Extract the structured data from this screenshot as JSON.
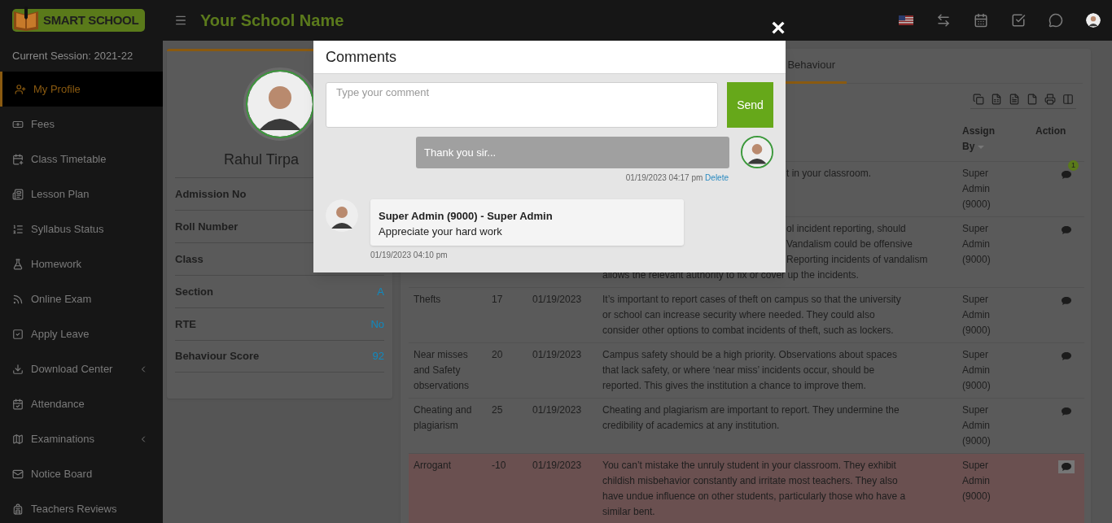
{
  "header": {
    "logo_text": "SMART SCHOOL",
    "school_name": "Your School Name"
  },
  "sidebar": {
    "session": "Current Session: 2021-22",
    "items": [
      {
        "label": "My Profile",
        "selected": true,
        "has_submenu": false
      },
      {
        "label": "Fees",
        "selected": false,
        "has_submenu": false
      },
      {
        "label": "Class Timetable",
        "selected": false,
        "has_submenu": false
      },
      {
        "label": "Lesson Plan",
        "selected": false,
        "has_submenu": false
      },
      {
        "label": "Syllabus Status",
        "selected": false,
        "has_submenu": false
      },
      {
        "label": "Homework",
        "selected": false,
        "has_submenu": false
      },
      {
        "label": "Online Exam",
        "selected": false,
        "has_submenu": false
      },
      {
        "label": "Apply Leave",
        "selected": false,
        "has_submenu": false
      },
      {
        "label": "Download Center",
        "selected": false,
        "has_submenu": true
      },
      {
        "label": "Attendance",
        "selected": false,
        "has_submenu": false
      },
      {
        "label": "Examinations",
        "selected": false,
        "has_submenu": true
      },
      {
        "label": "Notice Board",
        "selected": false,
        "has_submenu": false
      },
      {
        "label": "Teachers Reviews",
        "selected": false,
        "has_submenu": false
      }
    ]
  },
  "profile": {
    "name": "Rahul Tirpa",
    "fields": [
      {
        "label": "Admission No"
      },
      {
        "label": "Roll Number"
      },
      {
        "label": "Class"
      },
      {
        "label": "Section",
        "value": "A"
      },
      {
        "label": "RTE",
        "value": "No"
      },
      {
        "label": "Behaviour Score",
        "value": "92"
      }
    ]
  },
  "tabs": [
    {
      "label": "Behaviour",
      "selected": true
    }
  ],
  "table": {
    "columns": [
      "Assign By",
      "Action"
    ],
    "rows": [
      {
        "description_tail": [
          "t in your classroom."
        ],
        "assign_by": "Super Admin (9000)",
        "comment_count": "1",
        "highlighted": false,
        "hovered": false
      },
      {
        "description_tail": [
          "ol incident reporting, should",
          "Vandalism could be offensive",
          "Reporting incidents of vandalism"
        ],
        "description_lines": [
          "allows the relevant authority to fix or cover up the incidents."
        ],
        "assign_by": "Super Admin (9000)",
        "highlighted": false,
        "hovered": false
      },
      {
        "name": "Thefts",
        "points": "17",
        "date": "01/19/2023",
        "description_lines": [
          "It’s important to report cases of theft on campus so that the university",
          "or school can increase security where needed. They could also",
          "consider other options to combat incidents of theft, such as lockers."
        ],
        "assign_by": "Super Admin (9000)",
        "highlighted": false,
        "hovered": false
      },
      {
        "name": "Near misses and Safety observations",
        "points": "20",
        "date": "01/19/2023",
        "description_lines": [
          "Campus safety should be a high priority. Observations about spaces",
          "that lack safety, or where ‘near miss’ incidents occur, should be",
          "reported. This gives the institution a chance to improve them."
        ],
        "assign_by": "Super Admin (9000)",
        "highlighted": false,
        "hovered": false
      },
      {
        "name": "Cheating and plagiarism",
        "points": "25",
        "date": "01/19/2023",
        "description_lines": [
          "Cheating and plagiarism are important to report. They undermine the",
          "credibility of academics at any institution."
        ],
        "assign_by": "Super Admin (9000)",
        "highlighted": false,
        "hovered": false
      },
      {
        "name": "Arrogant",
        "points": "-10",
        "date": "01/19/2023",
        "description_lines": [
          "You can’t mistake the unruly student in your classroom. They exhibit",
          "childish misbehavior constantly and irritate most teachers. They also",
          "have undue influence on other students, particularly those who have a",
          "similar bent."
        ],
        "assign_by": "Super Admin (9000)",
        "highlighted": true,
        "hovered": true
      }
    ]
  },
  "modal": {
    "close": "×",
    "title": "Comments",
    "placeholder": "Type your comment",
    "send": "Send",
    "messages": [
      {
        "kind": "sent",
        "text": "Thank you sir...",
        "time": "01/19/2023 04:17 pm",
        "action": "Delete"
      },
      {
        "kind": "received",
        "author": "Super Admin (9000) - Super Admin",
        "text": "Appreciate your hard work",
        "time": "01/19/2023 04:10 pm"
      }
    ]
  }
}
